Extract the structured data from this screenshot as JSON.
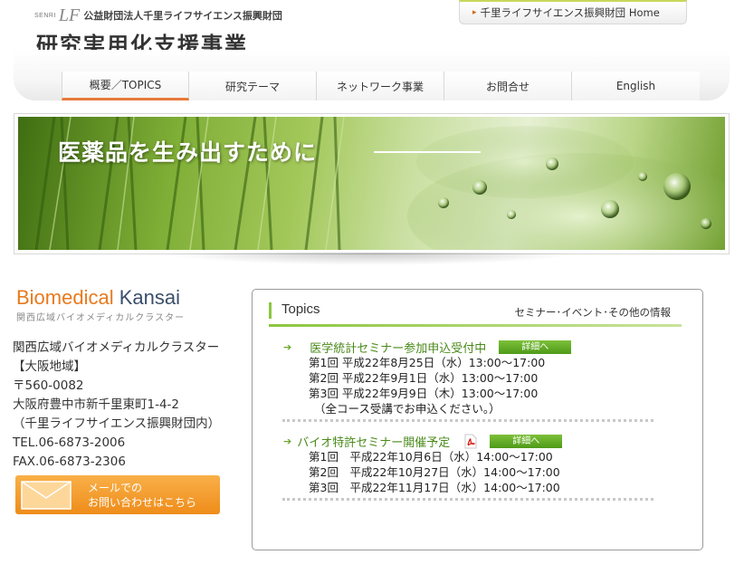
{
  "header": {
    "senri_mark": "SENRI",
    "lf_mark": "LF",
    "org_name": "公益財団法人千里ライフサイエンス振興財団",
    "program_title": "研究実用化支援事業",
    "home_link": "千里ライフサイエンス振興財団 Home"
  },
  "nav": {
    "items": [
      "概要／TOPICS",
      "研究テーマ",
      "ネットワーク事業",
      "お問合せ",
      "English"
    ],
    "active_index": 0
  },
  "hero": {
    "headline": "医薬品を生み出すために"
  },
  "sidebar": {
    "logo_bio": "Biomedical",
    "logo_kansai": "Kansai",
    "logo_sub": "関西広域バイオメディカルクラスター",
    "address_lines": [
      "関西広域バイオメディカルクラスター",
      "【大阪地域】",
      "〒560-0082",
      "大阪府豊中市新千里東町1-4-2",
      "（千里ライフサイエンス振興財団内）",
      "TEL.06-6873-2006",
      "FAX.06-6873-2306"
    ],
    "mail_button": {
      "line1": "メールでの",
      "line2": "お問い合わせはこちら"
    }
  },
  "topics": {
    "title": "Topics",
    "subtitle": "セミナー･イベント･その他の情報",
    "items": [
      {
        "title": "医学統計セミナー参加申込受付中",
        "button": "詳細へ",
        "lines": [
          "第1回 平成22年8月25日（水）13:00～17:00",
          "第2回 平成22年9月1日（水）13:00～17:00",
          "第3回 平成22年9月9日（木）13:00～17:00",
          "（全コース受講でお申込ください。）"
        ]
      },
      {
        "title": "バイオ特許セミナー開催予定",
        "button": "詳細へ",
        "has_pdf": true,
        "lines": [
          "第1回　平成22年10月6日（水）14:00～17:00",
          "第2回　平成22年10月27日（水）14:00～17:00",
          "第3回　平成22年11月17日（水）14:00～17:00"
        ]
      }
    ]
  },
  "colors": {
    "accent_green": "#8cc63f",
    "accent_orange": "#e87a1e",
    "button_green": "#5aa321"
  }
}
